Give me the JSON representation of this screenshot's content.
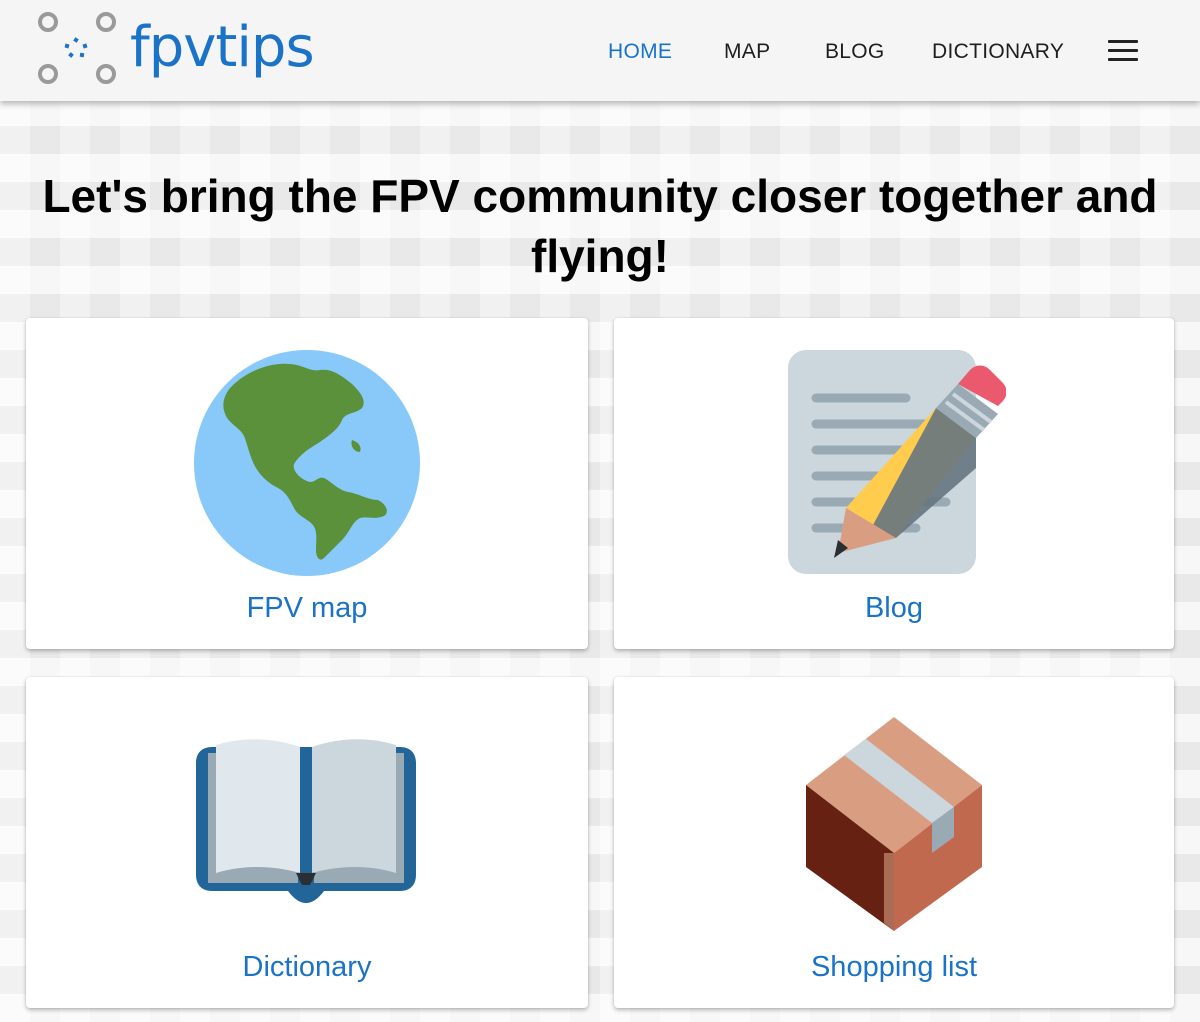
{
  "header": {
    "logo_text": "fpvtips",
    "nav": [
      {
        "label": "HOME",
        "active": true
      },
      {
        "label": "MAP",
        "active": false
      },
      {
        "label": "BLOG",
        "active": false
      },
      {
        "label": "DICTIONARY",
        "active": false
      }
    ],
    "menu_icon": "hamburger-menu-icon"
  },
  "headline": "Let's bring the FPV community closer together and flying!",
  "cards": [
    {
      "label": "FPV map",
      "icon": "globe-americas-icon"
    },
    {
      "label": "Blog",
      "icon": "memo-pencil-icon"
    },
    {
      "label": "Dictionary",
      "icon": "open-book-icon"
    },
    {
      "label": "Shopping list",
      "icon": "package-icon"
    }
  ],
  "colors": {
    "accent": "#1b73c8",
    "header_bg": "#f5f5f5",
    "logo_gray": "#9a9a9a"
  }
}
